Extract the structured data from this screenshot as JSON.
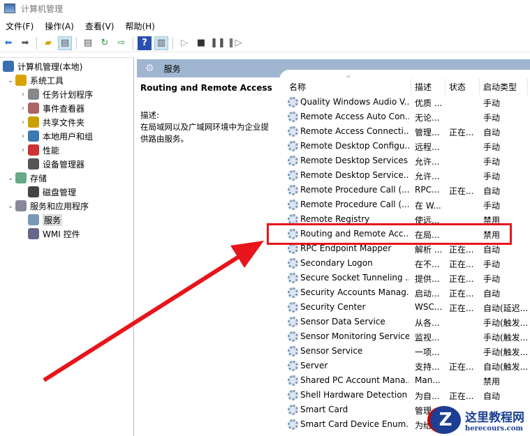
{
  "window": {
    "title": "计算机管理"
  },
  "menu": [
    "文件(F)",
    "操作(A)",
    "查看(V)",
    "帮助(H)"
  ],
  "toolbar": {
    "icons": [
      "back-arrow-icon",
      "forward-arrow-icon",
      "up-folder-icon",
      "show-tree-icon",
      "properties-icon",
      "refresh-icon",
      "export-icon",
      "help-icon",
      "show-action-pane-icon",
      "play-icon",
      "stop-icon",
      "pause-icon",
      "resume-icon"
    ]
  },
  "tree": [
    {
      "label": "计算机管理(本地)",
      "level": 0
    },
    {
      "label": "系统工具",
      "level": 1,
      "expanded": true
    },
    {
      "label": "任务计划程序",
      "level": 2
    },
    {
      "label": "事件查看器",
      "level": 2
    },
    {
      "label": "共享文件夹",
      "level": 2
    },
    {
      "label": "本地用户和组",
      "level": 2
    },
    {
      "label": "性能",
      "level": 2
    },
    {
      "label": "设备管理器",
      "level": 2
    },
    {
      "label": "存储",
      "level": 1,
      "expanded": true
    },
    {
      "label": "磁盘管理",
      "level": 2
    },
    {
      "label": "服务和应用程序",
      "level": 1,
      "expanded": true
    },
    {
      "label": "服务",
      "level": 2,
      "selected": true
    },
    {
      "label": "WMI 控件",
      "level": 2
    }
  ],
  "panel": {
    "title": "服务",
    "service_name": "Routing and Remote Access",
    "desc_label": "描述:",
    "desc_text": "在局域网以及广域网环境中为企业提供路由服务。"
  },
  "columns": [
    "名称",
    "描述",
    "状态",
    "启动类型"
  ],
  "services": [
    [
      "Quality Windows Audio V...",
      "优质 ...",
      "",
      "手动"
    ],
    [
      "Remote Access Auto Con...",
      "无论...",
      "",
      "手动"
    ],
    [
      "Remote Access Connecti...",
      "管理...",
      "正在...",
      "自动"
    ],
    [
      "Remote Desktop Configu...",
      "远程...",
      "",
      "手动"
    ],
    [
      "Remote Desktop Services",
      "允许...",
      "",
      "手动"
    ],
    [
      "Remote Desktop Service...",
      "允许...",
      "",
      "手动"
    ],
    [
      "Remote Procedure Call (...",
      "RPC...",
      "正在...",
      "自动"
    ],
    [
      "Remote Procedure Call (...",
      "在 W...",
      "",
      "手动"
    ],
    [
      "Remote Registry",
      "使远...",
      "",
      "禁用"
    ],
    [
      "Routing and Remote Acc...",
      "在局...",
      "",
      "禁用"
    ],
    [
      "RPC Endpoint Mapper",
      "解析 ...",
      "正在...",
      "自动"
    ],
    [
      "Secondary Logon",
      "在不...",
      "正在...",
      "手动"
    ],
    [
      "Secure Socket Tunneling ...",
      "提供...",
      "正在...",
      "手动"
    ],
    [
      "Security Accounts Manag...",
      "启动...",
      "正在...",
      "自动"
    ],
    [
      "Security Center",
      "WSC...",
      "正在...",
      "自动(延迟..."
    ],
    [
      "Sensor Data Service",
      "从各...",
      "",
      "手动(触发..."
    ],
    [
      "Sensor Monitoring Service",
      "监视...",
      "",
      "手动(触发..."
    ],
    [
      "Sensor Service",
      "一项...",
      "",
      "手动(触发..."
    ],
    [
      "Server",
      "支持...",
      "正在...",
      "自动(触发..."
    ],
    [
      "Shared PC Account Mana...",
      "Man...",
      "",
      "禁用"
    ],
    [
      "Shell Hardware Detection",
      "为自...",
      "正在...",
      "自动"
    ],
    [
      "Smart Card",
      "管理...",
      "",
      ""
    ],
    [
      "Smart Card Device Enum...",
      "为给...",
      "",
      ""
    ]
  ],
  "highlight_color": "#e8141b",
  "watermark": {
    "title": "这里教程网",
    "url": "herecours.com"
  }
}
